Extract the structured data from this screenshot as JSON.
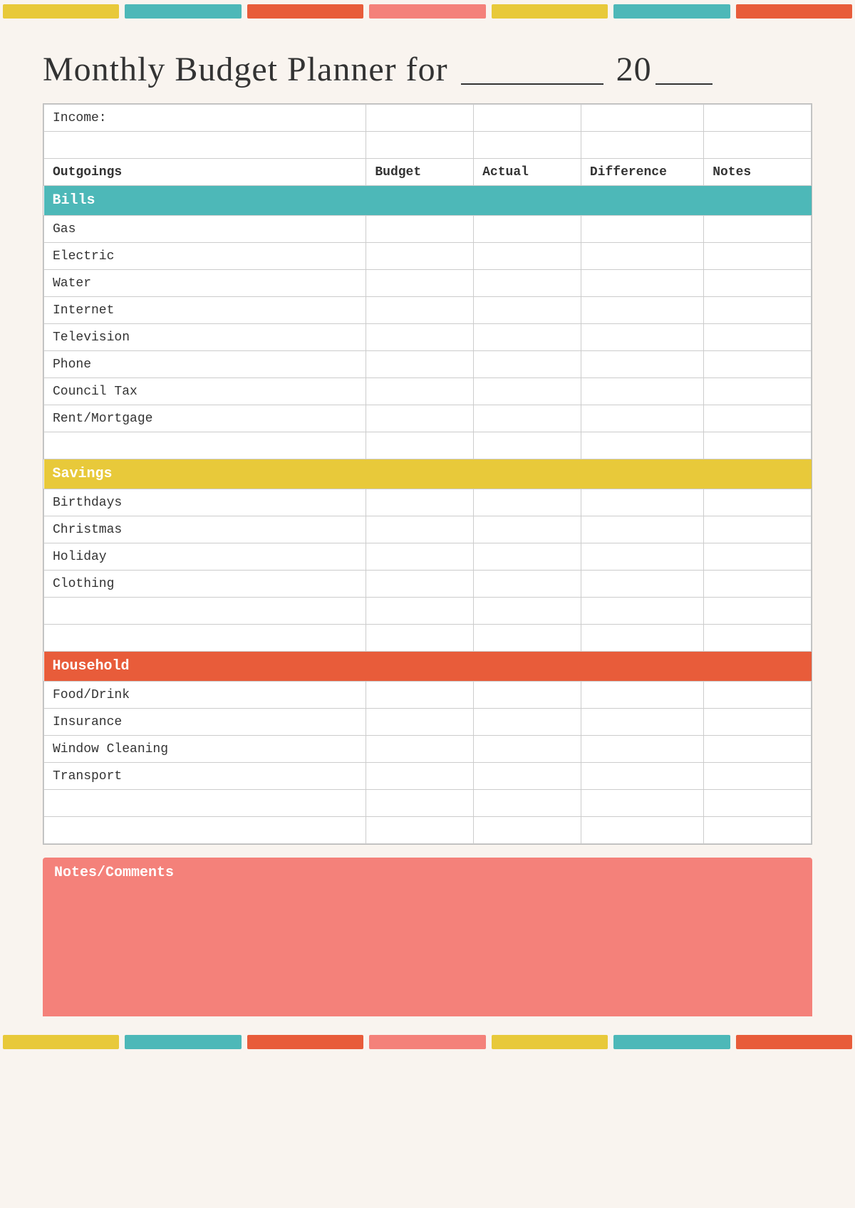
{
  "title": {
    "main": "Monthly Budget Planner for",
    "year_prefix": "20",
    "year_suffix": "__"
  },
  "deco_colors": [
    "yellow",
    "teal",
    "red",
    "pink",
    "yellow2",
    "teal2",
    "red2"
  ],
  "table": {
    "income_label": "Income:",
    "outgoings_header": {
      "category": "Outgoings",
      "budget": "Budget",
      "actual": "Actual",
      "difference": "Difference",
      "notes": "Notes"
    },
    "sections": {
      "bills": {
        "label": "Bills",
        "items": [
          "Gas",
          "Electric",
          "Water",
          "Internet",
          "Television",
          "Phone",
          "Council Tax",
          "Rent/Mortgage"
        ]
      },
      "savings": {
        "label": "Savings",
        "items": [
          "Birthdays",
          "Christmas",
          "Holiday",
          "Clothing"
        ]
      },
      "household": {
        "label": "Household",
        "items": [
          "Food/Drink",
          "Insurance",
          "Window Cleaning",
          "Transport"
        ]
      }
    }
  },
  "notes_section": {
    "label": "Notes/Comments"
  }
}
